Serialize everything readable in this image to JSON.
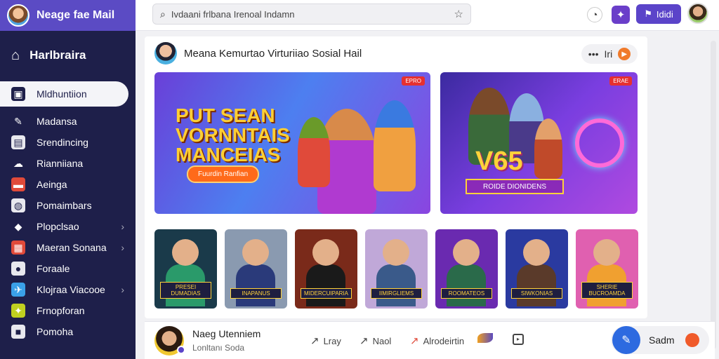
{
  "sidebar": {
    "brand": "Neage fae Mail",
    "home_label": "Harlbraira",
    "items": [
      {
        "label": "Mldhuntiion",
        "icon": "gift-icon",
        "active": true,
        "chevron": false
      },
      {
        "label": "Madansa",
        "icon": "pen-icon",
        "active": false,
        "chevron": false
      },
      {
        "label": "Srendincing",
        "icon": "calendar-icon",
        "active": false,
        "chevron": false
      },
      {
        "label": "Rianniiana",
        "icon": "chat-icon",
        "active": false,
        "chevron": false
      },
      {
        "label": "Aeinga",
        "icon": "ticket-icon",
        "active": false,
        "chevron": false
      },
      {
        "label": "Pomaimbars",
        "icon": "settings-icon",
        "active": false,
        "chevron": false
      },
      {
        "label": "Plopclsao",
        "icon": "puzzle-icon",
        "active": false,
        "chevron": true
      },
      {
        "label": "Maeran Sonana",
        "icon": "gallery-icon",
        "active": false,
        "chevron": true
      },
      {
        "label": "Foraale",
        "icon": "user-icon",
        "active": false,
        "chevron": false
      },
      {
        "label": "Klojraa Viacooe",
        "icon": "bird-icon",
        "active": false,
        "chevron": true
      },
      {
        "label": "Frnopforan",
        "icon": "ball-icon",
        "active": false,
        "chevron": false
      },
      {
        "label": "Pomoha",
        "icon": "bag-icon",
        "active": false,
        "chevron": false
      }
    ]
  },
  "topbar": {
    "search_value": "Ivdaani frlbana Irenoal Indamn",
    "button_label": "Ididi"
  },
  "card": {
    "title": "Meana Kemurtao Virturiiao Sosial Hail",
    "action_label": "Iri",
    "banner1": {
      "title": "PUT SEAN VORNNTAIS MANCEIAS",
      "cta": "Fuurdin Ranfian",
      "badge": "EPRO"
    },
    "banner2": {
      "big_text": "V65",
      "ribbon": "ROIDE DIONIDENS",
      "badge": "ERAE"
    },
    "thumbnails": [
      {
        "caption": "PRESEI DUMADIAS",
        "bg": "#1a3a4a",
        "body": "#2a9a6a"
      },
      {
        "caption": "INAPANUS",
        "bg": "#8a9ab0",
        "body": "#2a3a7a"
      },
      {
        "caption": "MIDERCUIPARIA",
        "bg": "#7a2a1a",
        "body": "#1a1a1a"
      },
      {
        "caption": "IIMIRGLIEMS",
        "bg": "#c0a8d8",
        "body": "#3a5a8a"
      },
      {
        "caption": "ROOMATEOS",
        "bg": "#6a2ab0",
        "body": "#2a6a4a"
      },
      {
        "caption": "SIWKONIAS",
        "bg": "#2a3aa0",
        "body": "#5a3a2a"
      },
      {
        "caption": "SHERIE BUCROAMDA",
        "bg": "#e060b0",
        "body": "#f0a030"
      }
    ]
  },
  "bottombar": {
    "name": "Naeg Utenniem",
    "subtitle": "Lonltanı Soda",
    "actions": [
      {
        "label": "Lray",
        "icon": "share-icon"
      },
      {
        "label": "Naol",
        "icon": "forward-icon"
      },
      {
        "label": "Alrodeirtin",
        "icon": "reply-icon"
      }
    ],
    "send_label": "Sadm"
  }
}
